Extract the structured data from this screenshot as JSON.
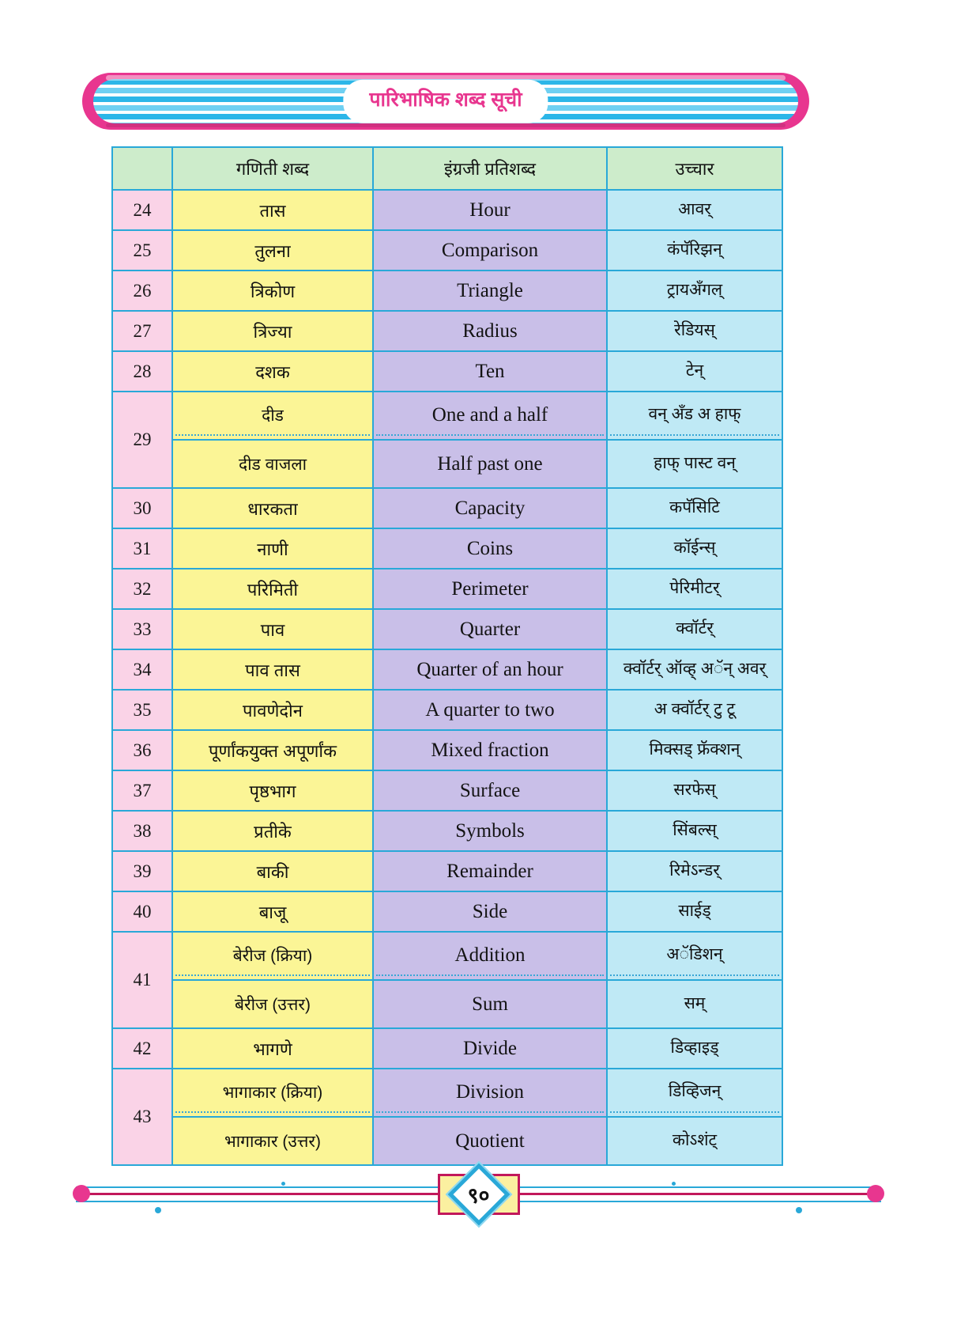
{
  "header": {
    "banner_title": "पारिभाषिक शब्द सूची"
  },
  "table": {
    "columns": [
      "",
      "गणिती शब्द",
      "इंग्रजी प्रतिशब्द",
      "उच्चार"
    ],
    "rows": [
      {
        "num": "24",
        "marathi": [
          "तास"
        ],
        "english": [
          "Hour"
        ],
        "pronunciation": [
          "आवर्"
        ]
      },
      {
        "num": "25",
        "marathi": [
          "तुलना"
        ],
        "english": [
          "Comparison"
        ],
        "pronunciation": [
          "कंपॅरिझन्"
        ]
      },
      {
        "num": "26",
        "marathi": [
          "त्रिकोण"
        ],
        "english": [
          "Triangle"
        ],
        "pronunciation": [
          "ट्रायअँगल्"
        ]
      },
      {
        "num": "27",
        "marathi": [
          "त्रिज्या"
        ],
        "english": [
          "Radius"
        ],
        "pronunciation": [
          "रेडियस्"
        ]
      },
      {
        "num": "28",
        "marathi": [
          "दशक"
        ],
        "english": [
          "Ten"
        ],
        "pronunciation": [
          "टेन्"
        ]
      },
      {
        "num": "29",
        "marathi": [
          "दीड",
          "दीड वाजला"
        ],
        "english": [
          "One and a half",
          "Half past one"
        ],
        "pronunciation": [
          "वन् अँड अ हाफ्",
          "हाफ् पास्ट वन्"
        ]
      },
      {
        "num": "30",
        "marathi": [
          "धारकता"
        ],
        "english": [
          "Capacity"
        ],
        "pronunciation": [
          "कपॅसिटि"
        ]
      },
      {
        "num": "31",
        "marathi": [
          "नाणी"
        ],
        "english": [
          "Coins"
        ],
        "pronunciation": [
          "कॉईन्स्"
        ]
      },
      {
        "num": "32",
        "marathi": [
          "परिमिती"
        ],
        "english": [
          "Perimeter"
        ],
        "pronunciation": [
          "पेरिमीटर्"
        ]
      },
      {
        "num": "33",
        "marathi": [
          "पाव"
        ],
        "english": [
          "Quarter"
        ],
        "pronunciation": [
          "क्वॉर्टर्"
        ]
      },
      {
        "num": "34",
        "marathi": [
          "पाव तास"
        ],
        "english": [
          "Quarter of an hour"
        ],
        "pronunciation": [
          "क्वॉर्टर् ऑव्ह् अॅन् अवर्"
        ]
      },
      {
        "num": "35",
        "marathi": [
          "पावणेदोन"
        ],
        "english": [
          "A quarter to two"
        ],
        "pronunciation": [
          "अ क्वॉर्टर् टु टू"
        ]
      },
      {
        "num": "36",
        "marathi": [
          "पूर्णांकयुक्त अपूर्णांक"
        ],
        "english": [
          "Mixed fraction"
        ],
        "pronunciation": [
          "मिक्सड् फ्रॅक्शन्"
        ]
      },
      {
        "num": "37",
        "marathi": [
          "पृष्ठभाग"
        ],
        "english": [
          "Surface"
        ],
        "pronunciation": [
          "सरफेस्"
        ]
      },
      {
        "num": "38",
        "marathi": [
          "प्रतीके"
        ],
        "english": [
          "Symbols"
        ],
        "pronunciation": [
          "सिंबल्स्"
        ]
      },
      {
        "num": "39",
        "marathi": [
          "बाकी"
        ],
        "english": [
          "Remainder"
        ],
        "pronunciation": [
          "रिमेऽन्डर्"
        ]
      },
      {
        "num": "40",
        "marathi": [
          "बाजू"
        ],
        "english": [
          "Side"
        ],
        "pronunciation": [
          "साईड्"
        ]
      },
      {
        "num": "41",
        "marathi": [
          "बेरीज (क्रिया)",
          "बेरीज (उत्तर)"
        ],
        "english": [
          "Addition",
          "Sum"
        ],
        "pronunciation": [
          "अॅडिशन्",
          "सम्"
        ]
      },
      {
        "num": "42",
        "marathi": [
          "भागणे"
        ],
        "english": [
          "Divide"
        ],
        "pronunciation": [
          "डिव्हाइड्"
        ]
      },
      {
        "num": "43",
        "marathi": [
          "भागाकार (क्रिया)",
          "भागाकार (उत्तर)"
        ],
        "english": [
          "Division",
          "Quotient"
        ],
        "pronunciation": [
          "डिव्हिजन्",
          "कोऽशंट्"
        ]
      }
    ]
  },
  "footer": {
    "page_number": "९०"
  },
  "colors": {
    "banner_pink": "#e8368f",
    "banner_blue": "#2cb6e8",
    "header_green": "#cdeccb",
    "num_pink": "#fad3e7",
    "marathi_yellow": "#fbf596",
    "english_purple": "#c9bfe8",
    "pronunciation_cyan": "#bfe9f5",
    "border_blue": "#29a8d8",
    "footer_magenta": "#c2185b"
  }
}
